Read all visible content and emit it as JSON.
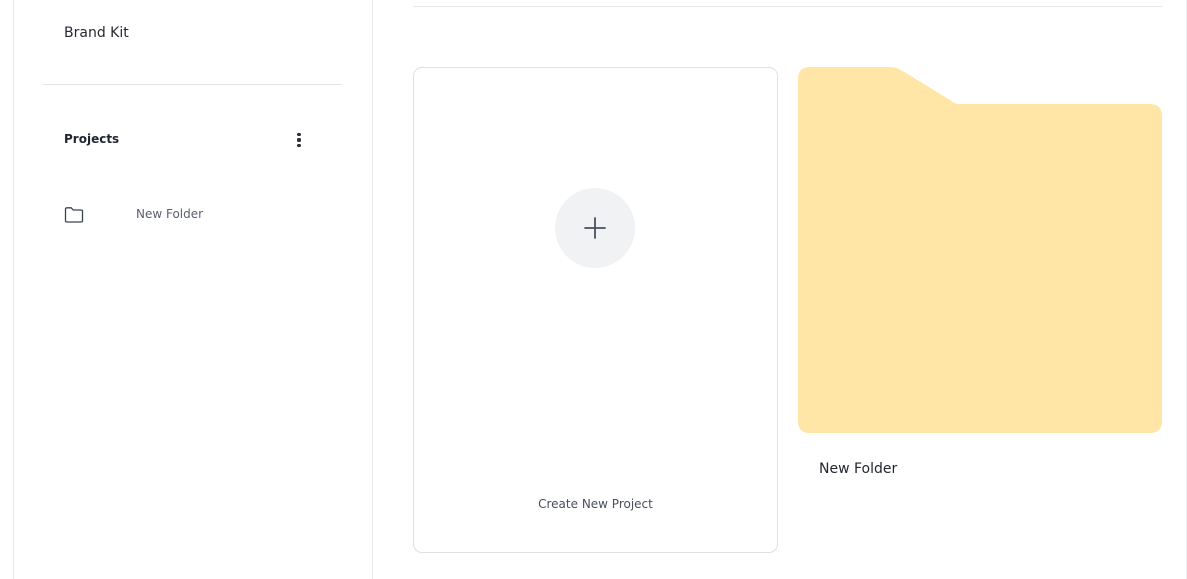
{
  "sidebar": {
    "brand_kit_label": "Brand Kit",
    "projects": {
      "title": "Projects",
      "menu_icon": "more-vertical-icon",
      "items": [
        {
          "label": "New Folder",
          "icon": "folder-icon"
        }
      ]
    }
  },
  "main": {
    "create_card": {
      "label": "Create New Project",
      "icon": "plus-icon"
    },
    "folders": [
      {
        "name": "New Folder",
        "color": "#FFE6A6"
      }
    ]
  },
  "colors": {
    "folder_fill": "#FFE6A6",
    "plus_circle_bg": "#F1F2F4",
    "border": "#DFE0E4"
  }
}
